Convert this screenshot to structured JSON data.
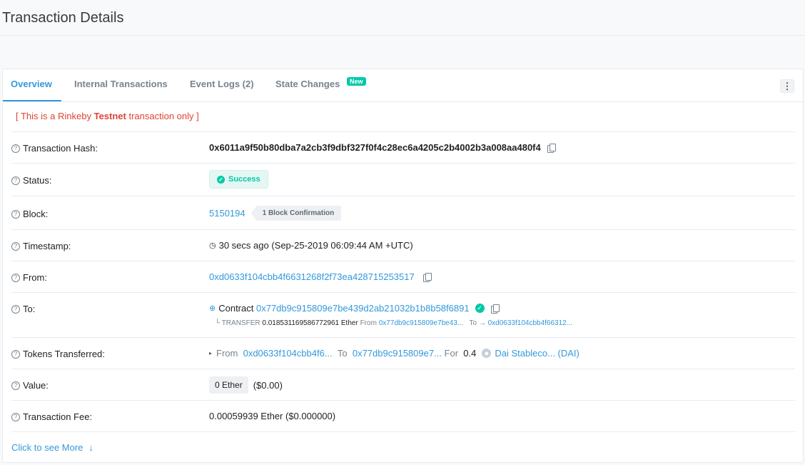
{
  "page": {
    "title": "Transaction Details"
  },
  "tabs": [
    {
      "label": "Overview"
    },
    {
      "label": "Internal Transactions"
    },
    {
      "label": "Event Logs (2)"
    },
    {
      "label": "State Changes"
    }
  ],
  "tabs_badge_new": "New",
  "more_menu_icon": "⋮",
  "notice": {
    "prefix": "[ This is a Rinkeby ",
    "bold": "Testnet",
    "suffix": " transaction only ]"
  },
  "help_icon_char": "?",
  "rows": {
    "hash": {
      "label": "Transaction Hash:",
      "value": "0x6011a9f50b80dba7a2cb3f9dbf327f0f4c28ec6a4205c2b4002b3a008aa480f4"
    },
    "status": {
      "label": "Status:",
      "value": "Success",
      "check": "✓"
    },
    "block": {
      "label": "Block:",
      "value": "5150194",
      "confirmations": "1 Block Confirmation"
    },
    "timestamp": {
      "label": "Timestamp:",
      "clock": "◷",
      "value": "30 secs ago (Sep-25-2019 06:09:44 AM +UTC)"
    },
    "from": {
      "label": "From:",
      "value": "0xd0633f104cbb4f6631268f2f73ea428715253517"
    },
    "to": {
      "label": "To:",
      "contract_icon": "⊕",
      "prefix": "Contract",
      "value": "0x77db9c915809e7be439d2ab21032b1b8b58f6891",
      "verified": "✓",
      "transfer": {
        "tree": "└",
        "type": "TRANSFER",
        "amount": "0.018531169586772961",
        "unit": "Ether",
        "from_label": "From",
        "from": "0x77db9c915809e7be43...",
        "to_label": "To",
        "arrow": "→",
        "to": "0xd0633f104cbb4f66312..."
      }
    },
    "tokens": {
      "label": "Tokens Transferred:",
      "caret": "▸",
      "from_label": "From",
      "from": "0xd0633f104cbb4f6...",
      "to_label": "To",
      "to": "0x77db9c915809e7...",
      "for_label": "For",
      "amount": "0.4",
      "token_icon": "◆",
      "token_name": "Dai Stableco... (DAI)"
    },
    "value": {
      "label": "Value:",
      "amount": "0 Ether",
      "usd": "($0.00)"
    },
    "fee": {
      "label": "Transaction Fee:",
      "value": "0.00059939 Ether ($0.000000)"
    }
  },
  "see_more": {
    "label": "Click to see More",
    "arrow": "↓"
  },
  "colors": {
    "link": "#3498db",
    "success": "#00c9a7",
    "danger": "#de4437",
    "muted": "#77838f"
  }
}
